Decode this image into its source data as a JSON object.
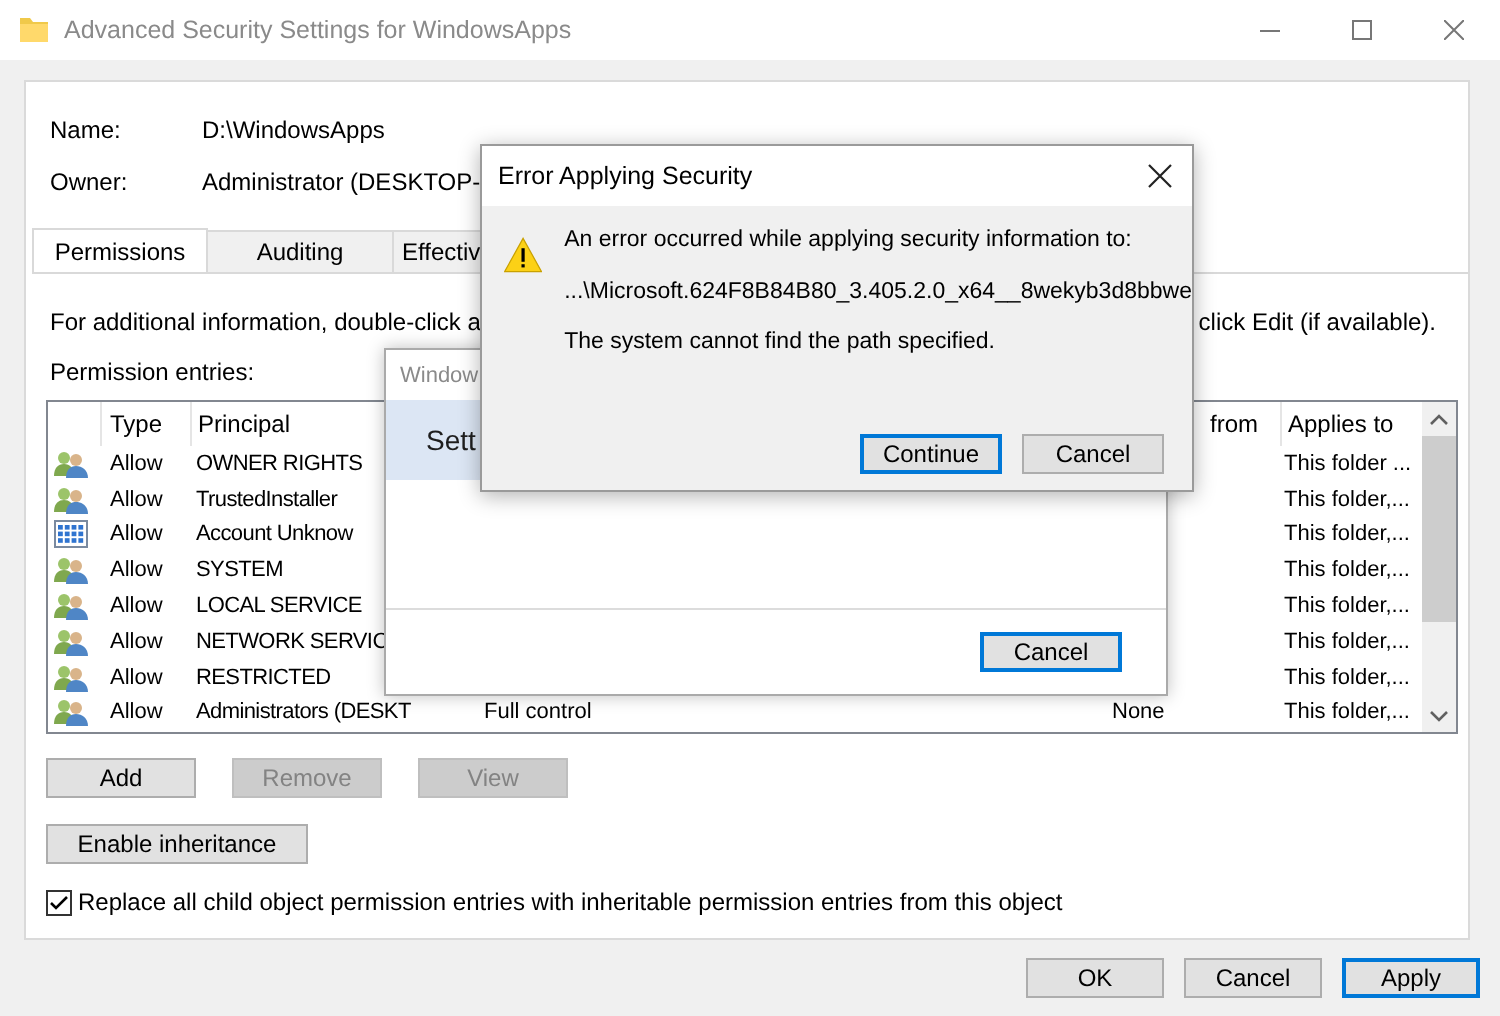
{
  "window": {
    "title": "Advanced Security Settings for WindowsApps",
    "active": false
  },
  "name": {
    "label": "Name:",
    "value": "D:\\WindowsApps"
  },
  "owner": {
    "label": "Owner:",
    "value": "Administrator (DESKTOP-"
  },
  "tabs": [
    {
      "label": "Permissions",
      "selected": true
    },
    {
      "label": "Auditing",
      "selected": false
    },
    {
      "label": "Effectiv",
      "selected": false
    }
  ],
  "info": [
    "For additional information, double-click a",
    "click Edit (if available)."
  ],
  "entries_label": "Permission entries:",
  "table": {
    "columns": [
      {
        "label": "Type"
      },
      {
        "label": "Principal"
      },
      {
        "label": "from"
      },
      {
        "label": "Applies to"
      }
    ],
    "rows": [
      {
        "kind": "group",
        "type": "Allow",
        "principal": "OWNER RIGHTS",
        "applies_to": "This folder ..."
      },
      {
        "kind": "group",
        "type": "Allow",
        "principal": "TrustedInstaller",
        "applies_to": "This folder,..."
      },
      {
        "kind": "account",
        "type": "Allow",
        "principal": "Account Unknow",
        "applies_to": "This folder,..."
      },
      {
        "kind": "group",
        "type": "Allow",
        "principal": "SYSTEM",
        "applies_to": "This folder,..."
      },
      {
        "kind": "group",
        "type": "Allow",
        "principal": "LOCAL SERVICE",
        "applies_to": "This folder,..."
      },
      {
        "kind": "group",
        "type": "Allow",
        "principal": "NETWORK SERVIC",
        "applies_to": "This folder,..."
      },
      {
        "kind": "group",
        "type": "Allow",
        "principal": "RESTRICTED",
        "applies_to": "This folder,..."
      },
      {
        "kind": "group",
        "type": "Allow",
        "principal": "Administrators (DESKT",
        "access": "Full control",
        "inherited": "None",
        "applies_to": "This folder,..."
      }
    ]
  },
  "buttons": [
    {
      "label": "Add",
      "disabled": false
    },
    {
      "label": "Remove",
      "disabled": true
    },
    {
      "label": "View",
      "disabled": true
    }
  ],
  "inheritance_button": {
    "label": "Enable inheritance"
  },
  "replace_checkbox": {
    "label": "Replace all child object permission entries with inheritable permission entries from this object",
    "checked": true
  },
  "footer_buttons": [
    {
      "label": "OK",
      "default": false
    },
    {
      "label": "Cancel",
      "default": false
    },
    {
      "label": "Apply",
      "default": true
    }
  ],
  "progress_dialog": {
    "title": "Window",
    "heading": "Sett",
    "button": {
      "label": "Cancel",
      "default": true
    }
  },
  "error_dialog": {
    "title": "Error Applying Security",
    "messages": [
      "An error occurred while applying security information to:",
      "...\\Microsoft.624F8B84B80_3.405.2.0_x64__8wekyb3d8bbwe",
      "The system cannot find the path specified."
    ],
    "buttons": [
      {
        "label": "Continue",
        "default": true
      },
      {
        "label": "Cancel",
        "default": false
      }
    ]
  }
}
